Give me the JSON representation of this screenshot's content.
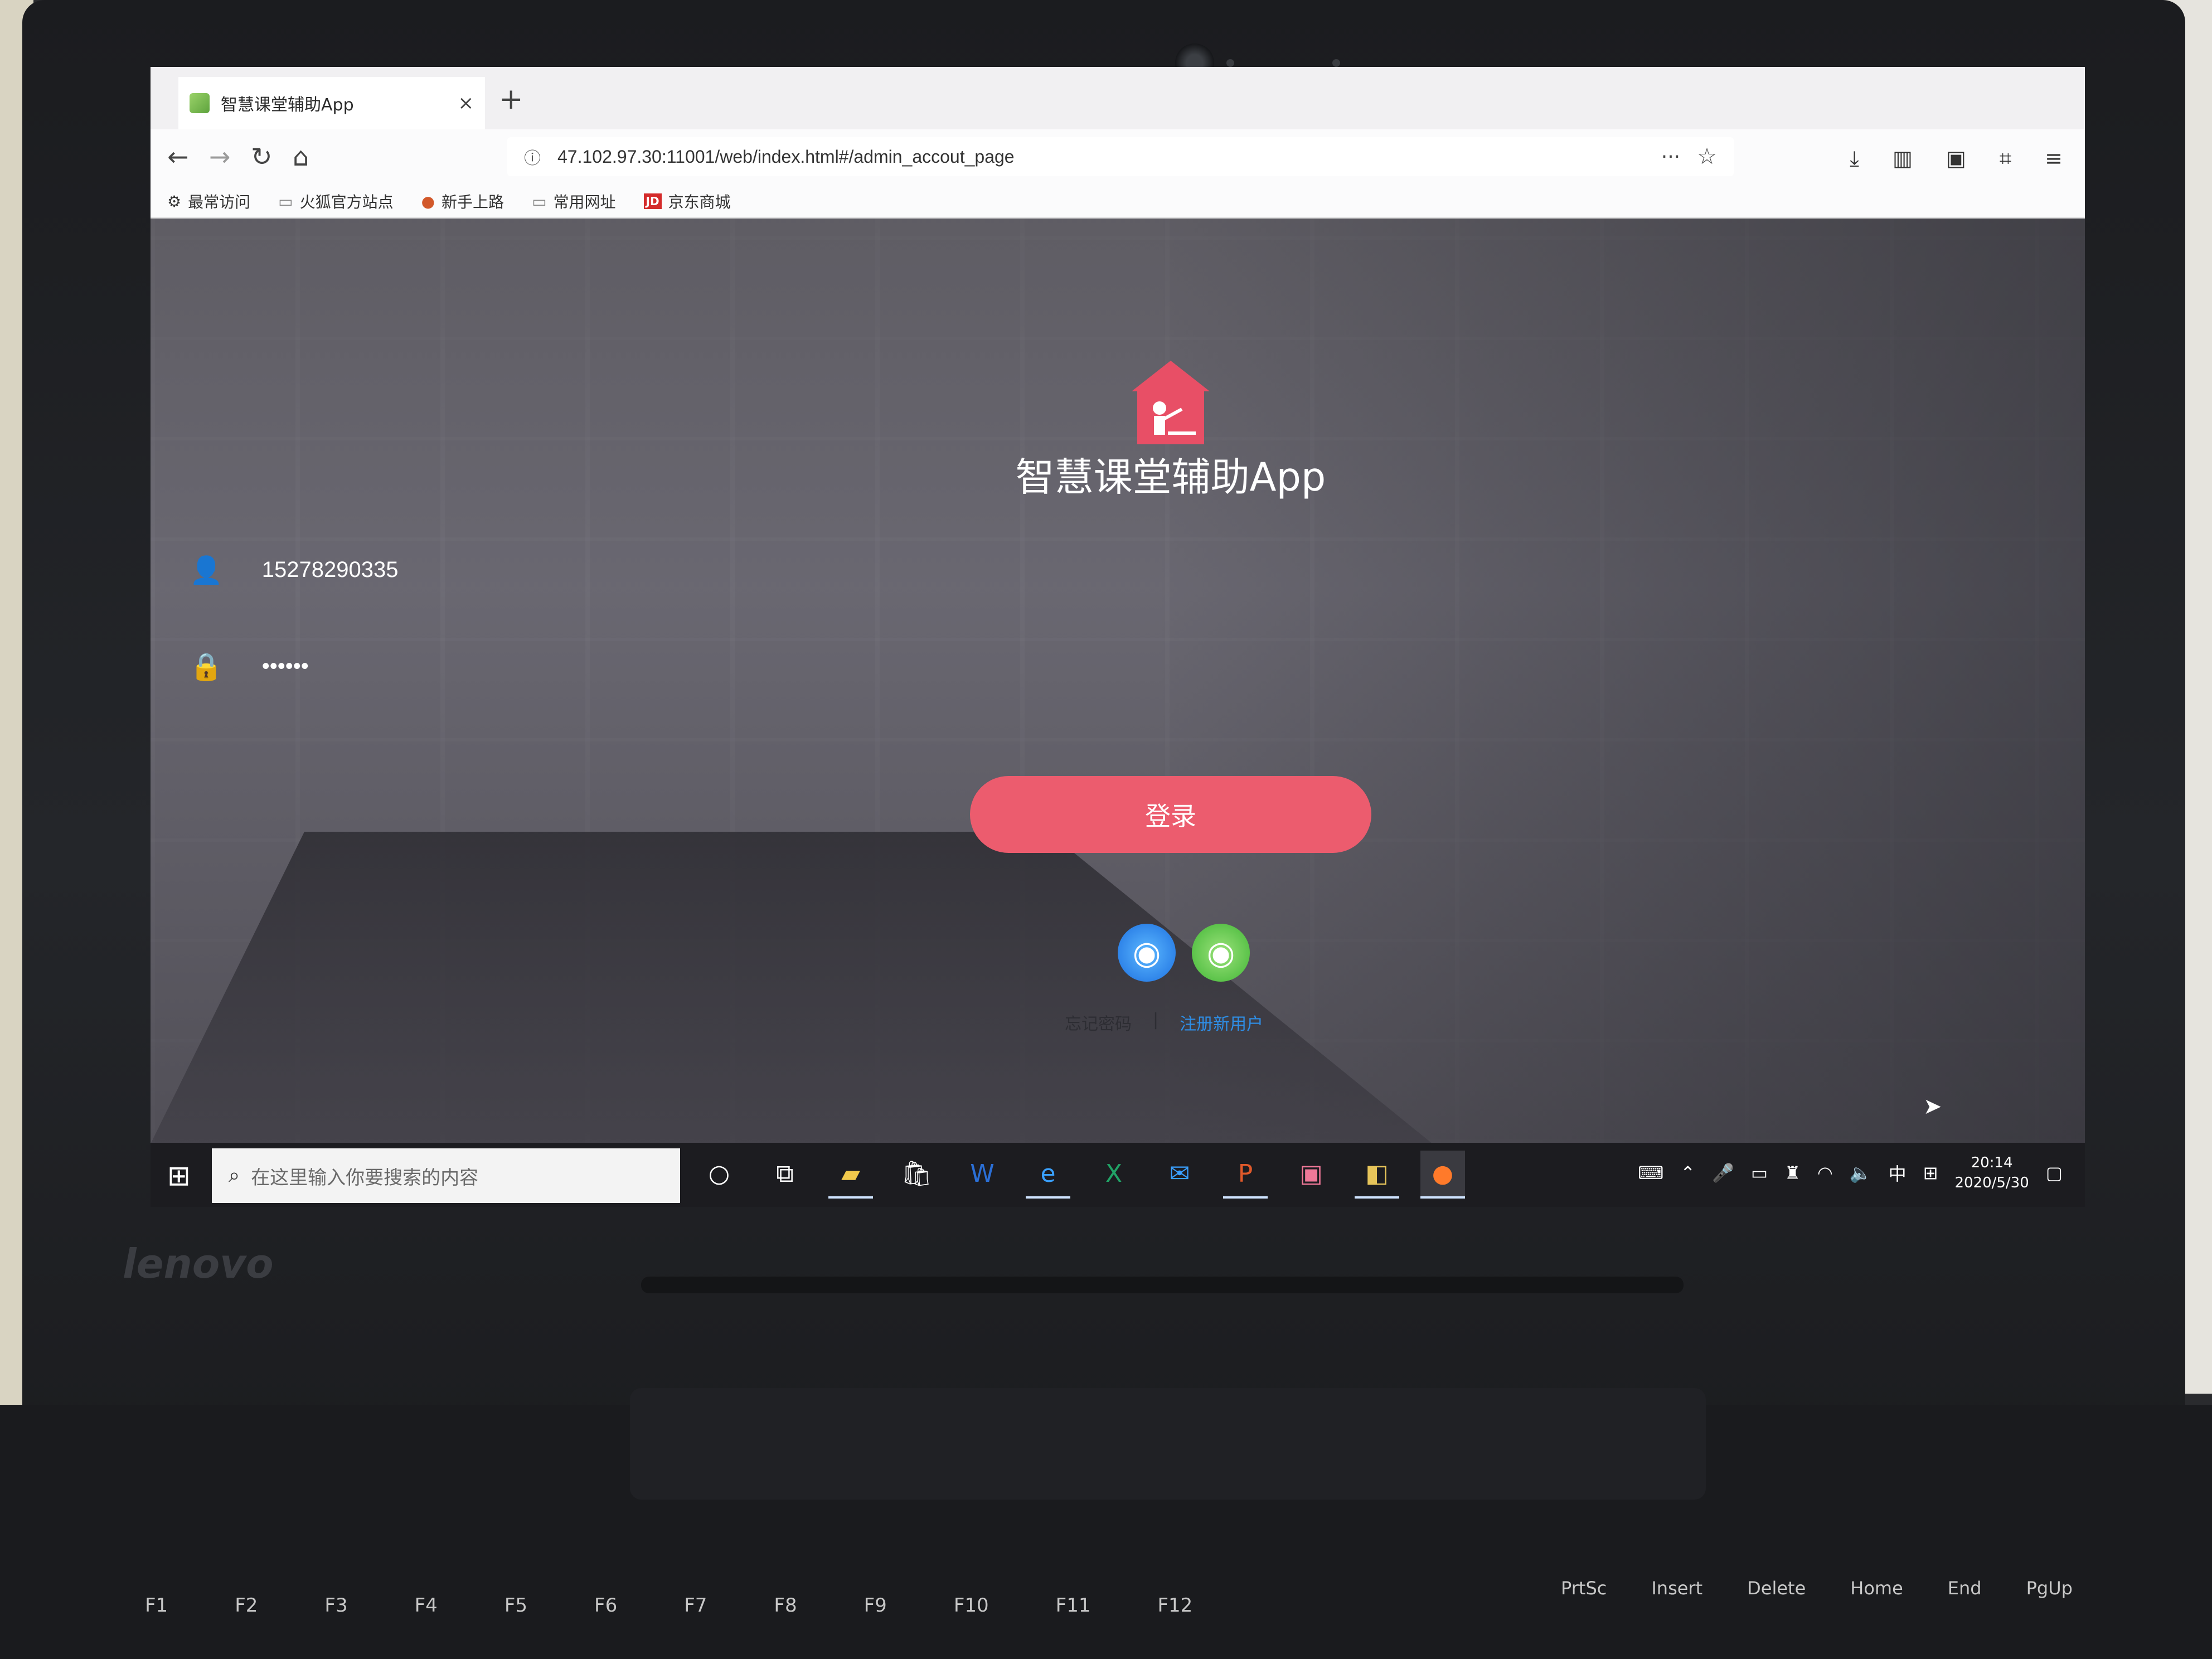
{
  "browser": {
    "tab_title": "智慧课堂辅助App",
    "new_tab": "+",
    "close_tab": "×",
    "url": "47.102.97.30:11001/web/index.html#/admin_accout_page",
    "url_more": "···",
    "bookmarks": [
      {
        "icon": "gear-icon",
        "label": "最常访问"
      },
      {
        "icon": "folder-icon",
        "label": "火狐官方站点"
      },
      {
        "icon": "firefox-icon",
        "label": "新手上路"
      },
      {
        "icon": "folder-icon",
        "label": "常用网址"
      },
      {
        "icon": "jd-icon",
        "label": "京东商城"
      }
    ]
  },
  "app": {
    "title": "智慧课堂辅助App",
    "accent_color": "#ec5c6e",
    "username": "15278290335",
    "password": "••••••",
    "login_label": "登录",
    "forgot_label": "忘记密码",
    "separator": "|",
    "register_label": "注册新用户",
    "social": [
      {
        "icon": "qq-icon"
      },
      {
        "icon": "wechat-icon"
      }
    ]
  },
  "taskbar": {
    "search_placeholder": "在这里输入你要搜索的内容",
    "ime": "中",
    "time": "20:14",
    "date": "2020/5/30"
  },
  "hardware": {
    "brand": "lenovo",
    "keys": [
      "F1",
      "F2",
      "F3",
      "F4",
      "F5",
      "F6",
      "F7",
      "F8",
      "F9",
      "F10",
      "F11",
      "F12"
    ],
    "keys_right": [
      "PrtSc",
      "Insert",
      "Delete",
      "Home",
      "End",
      "PgUp"
    ]
  }
}
